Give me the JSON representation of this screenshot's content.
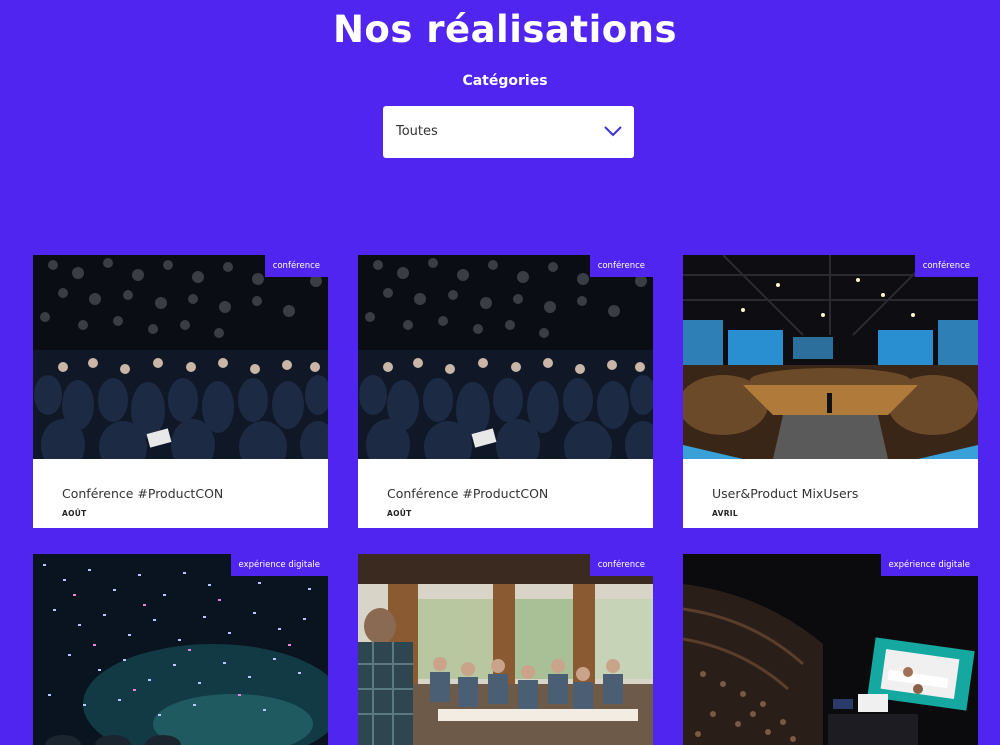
{
  "header": {
    "title": "Nos réalisations",
    "categories_label": "Catégories"
  },
  "filter": {
    "selected": "Toutes"
  },
  "cards": [
    {
      "tag": "conférence",
      "title": "Conférence #ProductCON",
      "date": "AOÛT"
    },
    {
      "tag": "conférence",
      "title": "Conférence #ProductCON",
      "date": "AOÛT"
    },
    {
      "tag": "conférence",
      "title": "User&Product MixUsers",
      "date": "AVRIL"
    },
    {
      "tag": "expérience digitale",
      "title": "",
      "date": ""
    },
    {
      "tag": "conférence",
      "title": "",
      "date": ""
    },
    {
      "tag": "expérience digitale",
      "title": "",
      "date": ""
    }
  ],
  "colors": {
    "background": "#5125f0",
    "card": "#ffffff",
    "accent": "#5125f0"
  },
  "icons": {
    "dropdown": "chevron-down-icon"
  }
}
